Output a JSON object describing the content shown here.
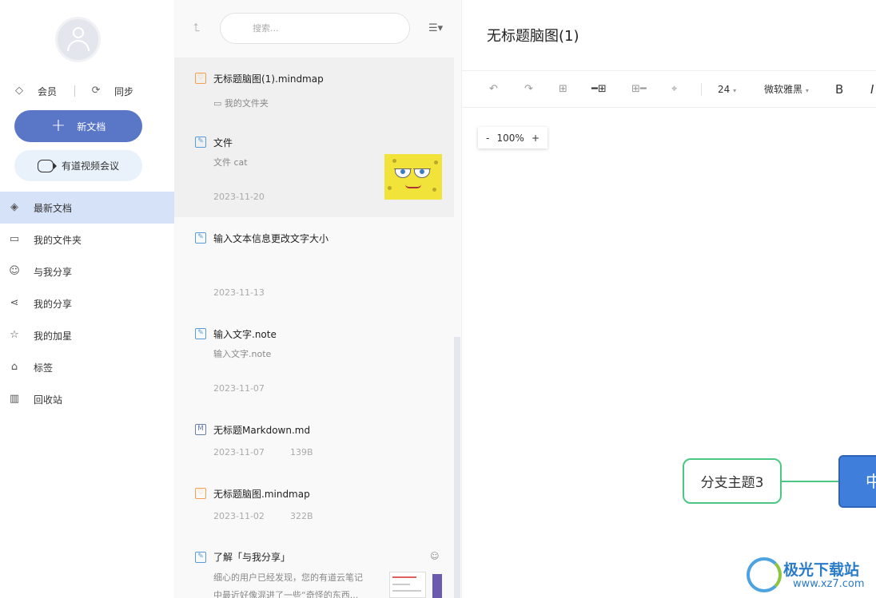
{
  "sidebar": {
    "vip_label": "会员",
    "sync_label": "同步",
    "new_doc_label": "新文档",
    "video_meeting_label": "有道视频会议",
    "nav": [
      {
        "label": "最新文档",
        "icon": "layers-icon",
        "active": true
      },
      {
        "label": "我的文件夹",
        "icon": "folder-icon"
      },
      {
        "label": "与我分享",
        "icon": "shared-with-me-icon"
      },
      {
        "label": "我的分享",
        "icon": "share-icon"
      },
      {
        "label": "我的加星",
        "icon": "star-icon"
      },
      {
        "label": "标签",
        "icon": "tag-icon"
      },
      {
        "label": "回收站",
        "icon": "trash-icon"
      }
    ]
  },
  "doclist": {
    "search_placeholder": "搜索...",
    "docs": [
      {
        "title": "无标题脑图(1).mindmap",
        "subtitle": "我的文件夹",
        "type": "mindmap",
        "selected": true
      },
      {
        "title": "文件",
        "subtitle": "文件 cat",
        "date": "2023-11-20",
        "type": "note"
      },
      {
        "title": "输入文本信息更改文字大小",
        "date": "2023-11-13",
        "type": "note"
      },
      {
        "title": "输入文字.note",
        "subtitle": "输入文字.note",
        "date": "2023-11-07",
        "type": "note"
      },
      {
        "title": "无标题Markdown.md",
        "date": "2023-11-07",
        "size": "139B",
        "type": "markdown"
      },
      {
        "title": "无标题脑图.mindmap",
        "date": "2023-11-02",
        "size": "322B",
        "type": "mindmap"
      },
      {
        "title": "了解「与我分享」",
        "subtitle_line1": "细心的用户已经发现，您的有道云笔记",
        "subtitle_line2": "中最近好像混进了一些“奇怪的东西...",
        "type": "note"
      }
    ]
  },
  "editor": {
    "title": "无标题脑图(1)",
    "font_size": "24",
    "font_family": "微软雅黑",
    "bold_label": "B",
    "italic_label": "I",
    "zoom_minus": "-",
    "zoom_value": "100%",
    "zoom_plus": "+",
    "branch_topic": "分支主题3",
    "center_topic": "中"
  },
  "watermark": {
    "name": "极光下载站",
    "url": "www.xz7.com"
  },
  "colors": {
    "accent": "#5a76c6",
    "nav_active_bg": "#d6e2f7",
    "branch_border": "#4cc783",
    "center_node": "#3f7fdb"
  }
}
